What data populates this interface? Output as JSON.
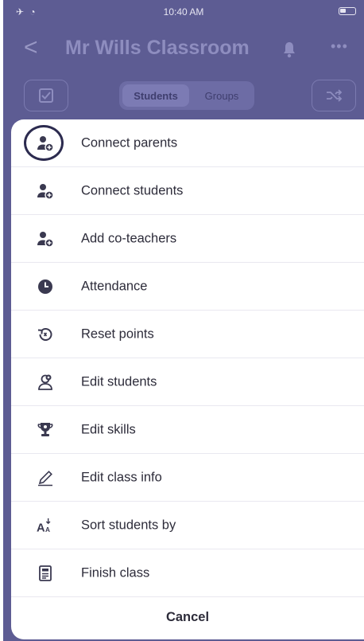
{
  "status_bar": {
    "left": "✈ ◔",
    "time": "10:40 AM"
  },
  "nav": {
    "back": "<",
    "title": "Mr Wills Classroom",
    "more": "•••"
  },
  "toolbar": {
    "tab_students": "Students",
    "tab_groups": "Groups"
  },
  "menu": {
    "items": [
      {
        "label": "Connect parents",
        "icon": "add-person-icon"
      },
      {
        "label": "Connect students",
        "icon": "add-person-icon"
      },
      {
        "label": "Add co-teachers",
        "icon": "add-person-icon"
      },
      {
        "label": "Attendance",
        "icon": "clock-icon"
      },
      {
        "label": "Reset points",
        "icon": "reset-icon"
      },
      {
        "label": "Edit students",
        "icon": "edit-students-icon"
      },
      {
        "label": "Edit skills",
        "icon": "trophy-icon"
      },
      {
        "label": "Edit class info",
        "icon": "pencil-icon"
      },
      {
        "label": "Sort students by",
        "icon": "sort-icon"
      },
      {
        "label": "Finish class",
        "icon": "finish-icon"
      }
    ],
    "cancel": "Cancel"
  },
  "colors": {
    "overlay": "#5d5c93",
    "icon": "#3a3950",
    "highlight_ring": "#2c2b4f"
  }
}
